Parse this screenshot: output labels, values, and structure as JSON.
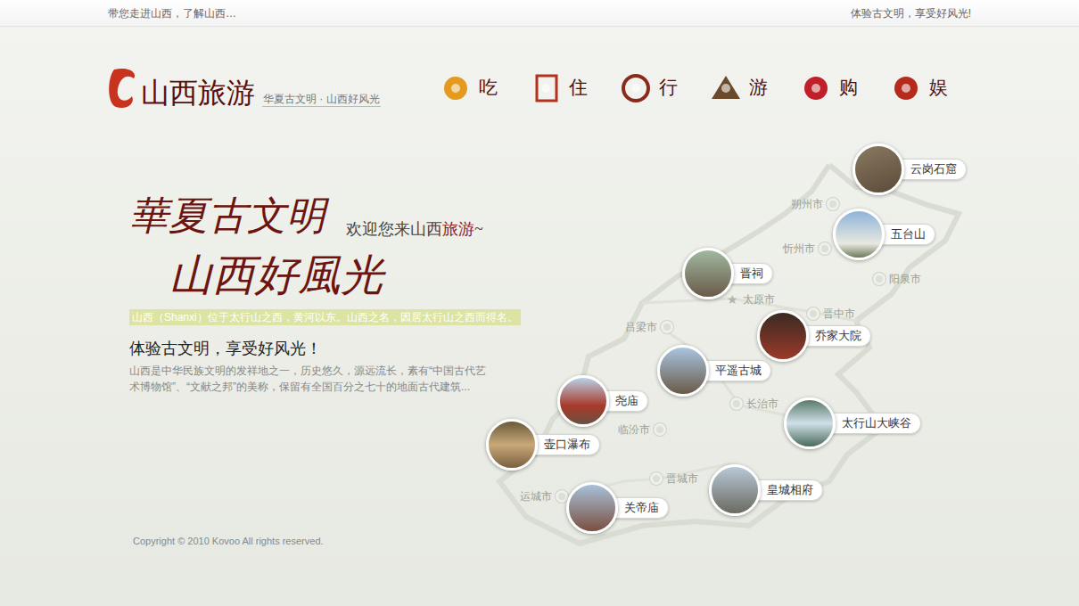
{
  "topbar": {
    "left": "带您走进山西，了解山西…",
    "right": "体验古文明，享受好风光!"
  },
  "logo": {
    "title": "山西旅游",
    "subtitle": "华夏古文明 · 山西好风光"
  },
  "nav": [
    {
      "label": "吃"
    },
    {
      "label": "住"
    },
    {
      "label": "行"
    },
    {
      "label": "游"
    },
    {
      "label": "购"
    },
    {
      "label": "娱"
    }
  ],
  "hero": {
    "calligraphy": [
      "華夏古文明",
      "山西好風光"
    ],
    "welcome": "欢迎您来山西",
    "welcome_highlight": "旅游",
    "welcome_tail": "~",
    "intro": "山西（Shanxi）位于太行山之西，黄河以东。山西之名，因居太行山之西而得名。",
    "heading": "体验古文明，享受好风光！",
    "body": "山西是中华民族文明的发祥地之一，历史悠久，源远流长，素有“中国古代艺术博物馆”、“文献之邦”的美称，保留有全国百分之七十的地面古代建筑..."
  },
  "map": {
    "cities": [
      {
        "name": "朔州市",
        "kind": "city"
      },
      {
        "name": "忻州市",
        "kind": "city"
      },
      {
        "name": "阳泉市",
        "kind": "city"
      },
      {
        "name": "太原市",
        "kind": "capital"
      },
      {
        "name": "晋中市",
        "kind": "city"
      },
      {
        "name": "吕梁市",
        "kind": "city"
      },
      {
        "name": "长治市",
        "kind": "city"
      },
      {
        "name": "临汾市",
        "kind": "city"
      },
      {
        "name": "晋城市",
        "kind": "city"
      },
      {
        "name": "运城市",
        "kind": "city"
      }
    ],
    "attractions": [
      {
        "name": "云岗石窟"
      },
      {
        "name": "五台山"
      },
      {
        "name": "晋祠"
      },
      {
        "name": "乔家大院"
      },
      {
        "name": "平遥古城"
      },
      {
        "name": "尧庙"
      },
      {
        "name": "壶口瀑布"
      },
      {
        "name": "太行山大峡谷"
      },
      {
        "name": "皇城相府"
      },
      {
        "name": "关帝庙"
      }
    ]
  },
  "footer": {
    "copyright": "Copyright © 2010 Kovoo All rights reserved."
  }
}
